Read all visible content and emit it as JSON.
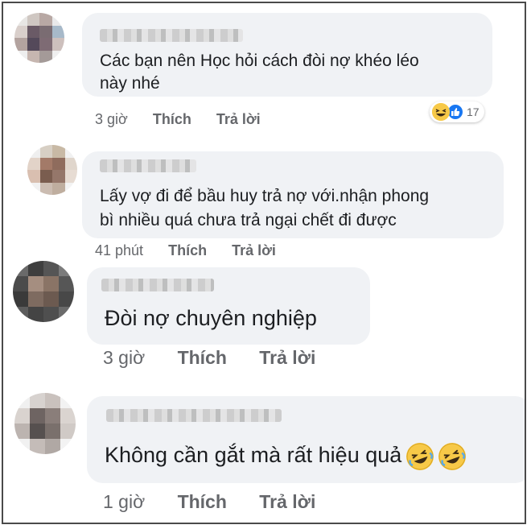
{
  "comments": [
    {
      "text_lines": [
        "Các bạn nên Học hỏi cách đòi nợ khéo léo",
        "này nhé"
      ],
      "time": "3 giờ",
      "like_label": "Thích",
      "reply_label": "Trả lời",
      "reactions": {
        "icons": [
          "haha-icon",
          "like-icon"
        ],
        "count": "17"
      }
    },
    {
      "text_lines": [
        "Lấy vợ đi để bầu huy trả nợ với.nhận phong",
        "bì nhiều quá chưa trả ngại chết đi được"
      ],
      "time": "41 phút",
      "like_label": "Thích",
      "reply_label": "Trả lời"
    },
    {
      "text_lines": [
        "Đòi nợ chuyên nghiệp"
      ],
      "time": "3 giờ",
      "like_label": "Thích",
      "reply_label": "Trả lời"
    },
    {
      "text_lines": [
        "Không cần gắt mà rất hiệu quả"
      ],
      "trailing_emoji": [
        "rofl-icon",
        "rofl-icon"
      ],
      "time": "1 giờ",
      "like_label": "Thích",
      "reply_label": "Trả lời"
    }
  ],
  "colors": {
    "bubble": "#f0f2f5",
    "text": "#1c1e21",
    "meta": "#65676b",
    "like_blue": "#1877f2",
    "emoji_yellow": "#f7c948",
    "frame_border": "#4a4a4a"
  }
}
